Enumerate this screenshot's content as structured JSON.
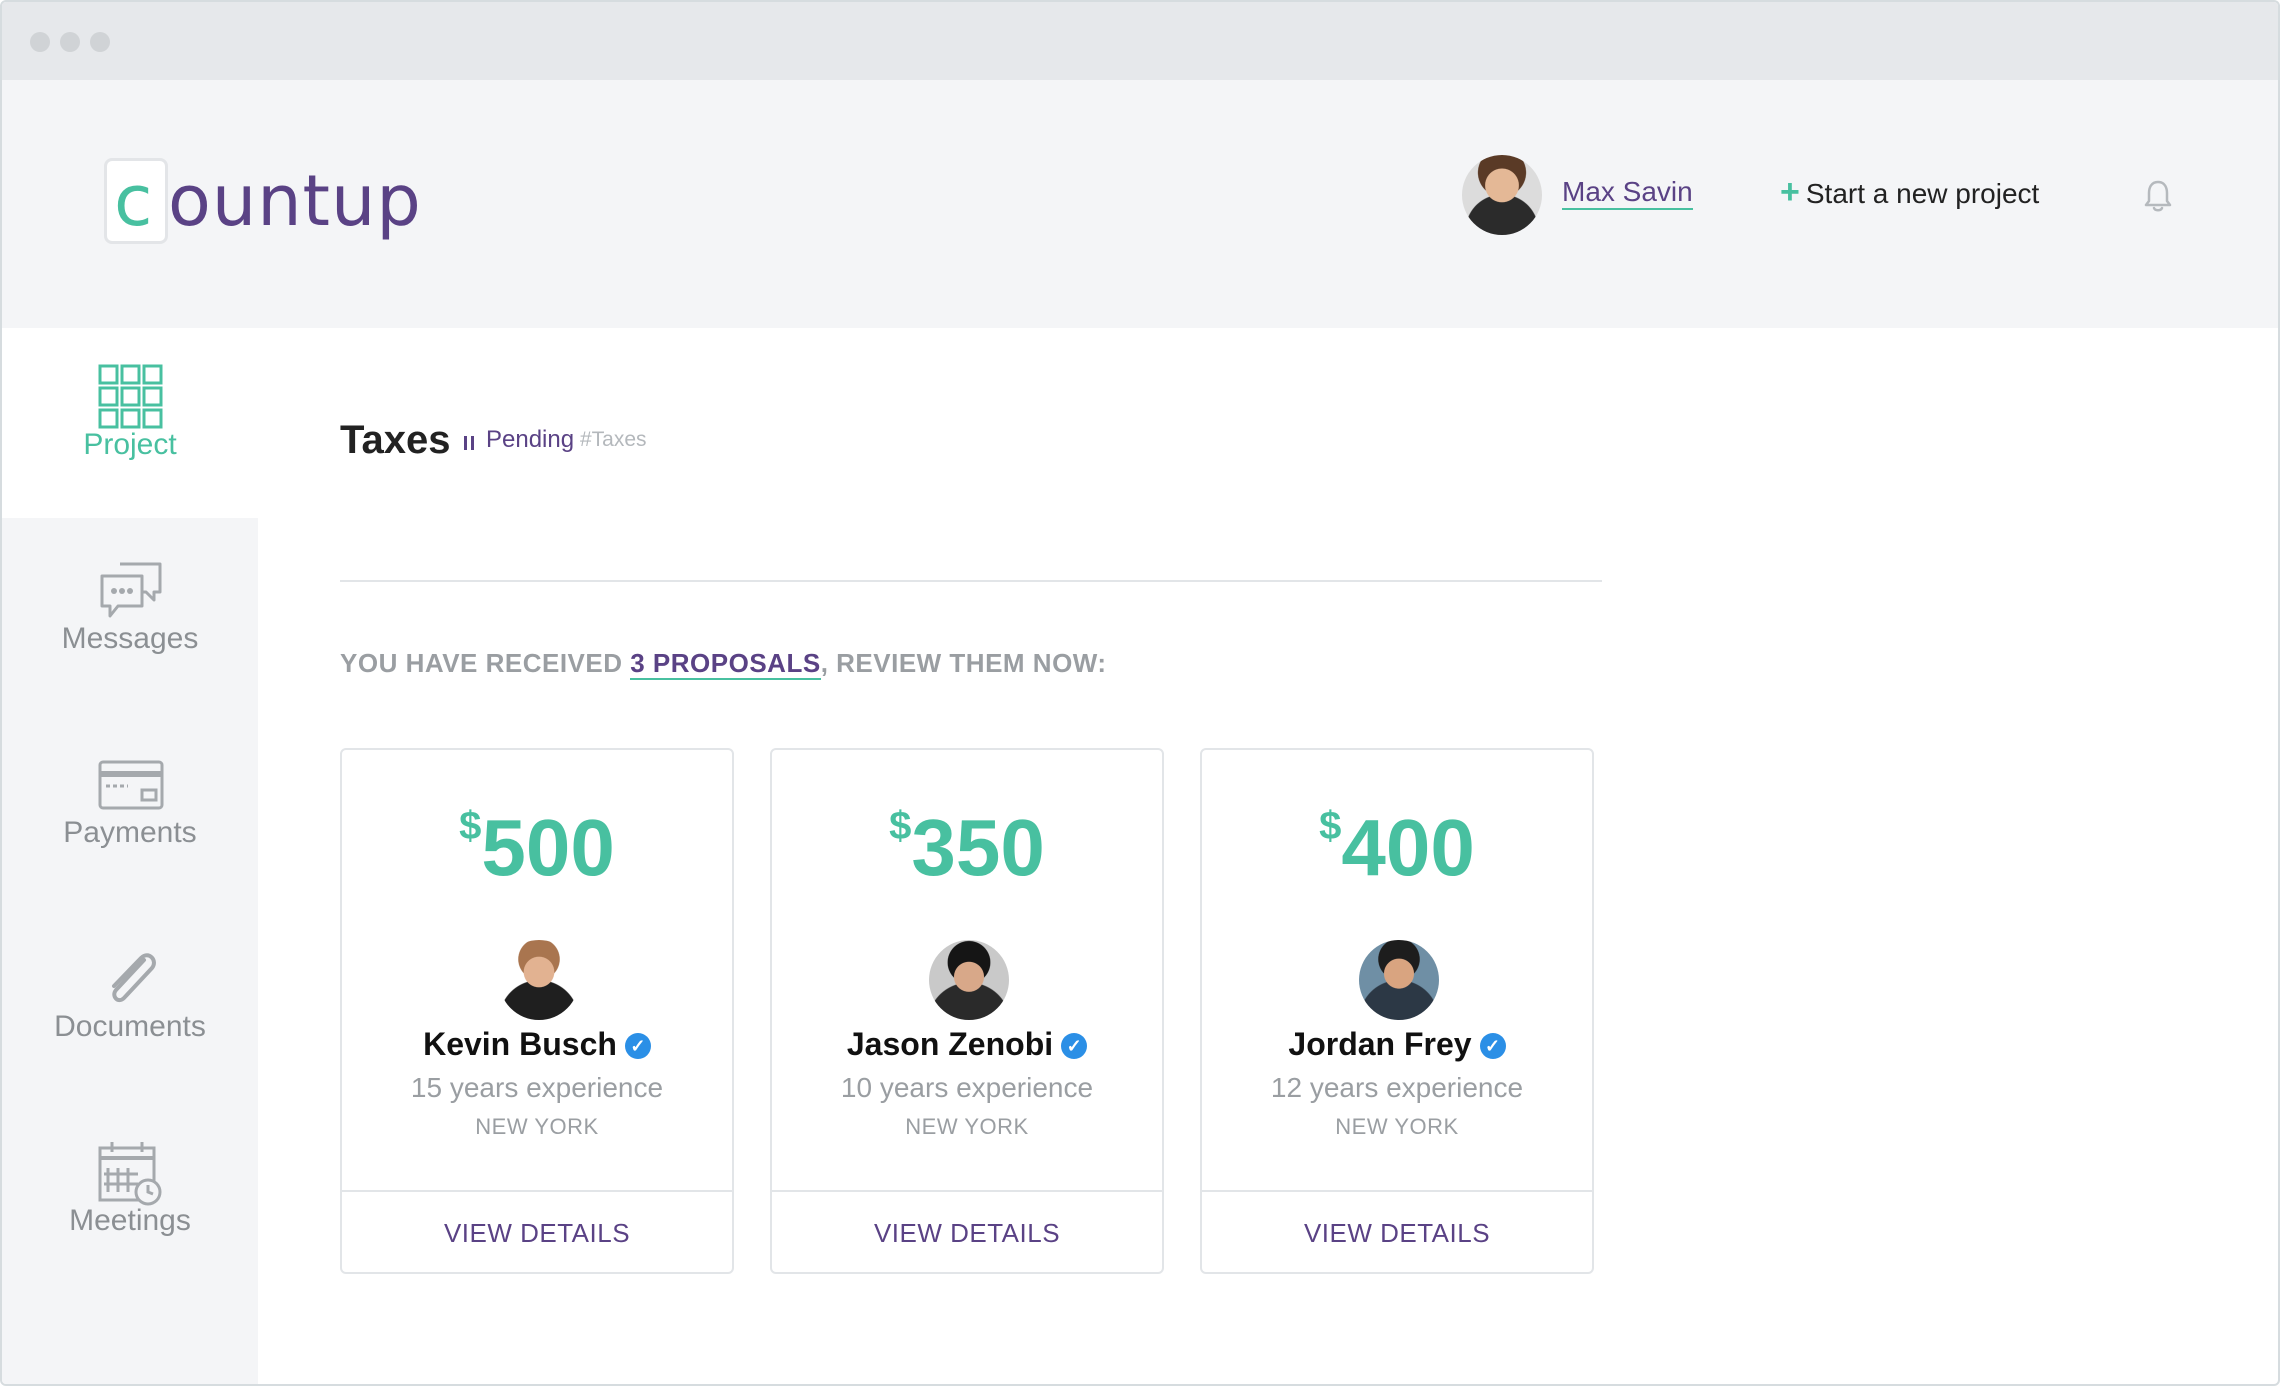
{
  "header": {
    "logo_c": "c",
    "logo_text": "ountup",
    "user_name": "Max Savin",
    "new_project_icon": "+",
    "new_project_label": "Start a new project"
  },
  "sidebar": {
    "items": [
      {
        "label": "Project",
        "icon": "grid-icon",
        "active": true
      },
      {
        "label": "Messages",
        "icon": "chat-icon",
        "active": false
      },
      {
        "label": "Payments",
        "icon": "credit-card-icon",
        "active": false
      },
      {
        "label": "Documents",
        "icon": "paperclip-icon",
        "active": false
      },
      {
        "label": "Meetings",
        "icon": "calendar-icon",
        "active": false
      }
    ]
  },
  "project": {
    "title": "Taxes",
    "status": "Pending",
    "tag": "#Taxes"
  },
  "proposals": {
    "prefix": "YOU HAVE RECEIVED ",
    "count_label": "3 PROPOSALS",
    "suffix": ", REVIEW THEM NOW:"
  },
  "cards": [
    {
      "currency": "$",
      "amount": "500",
      "name": "Kevin Busch",
      "experience": "15 years experience",
      "city": "NEW YORK",
      "button": "VIEW DETAILS"
    },
    {
      "currency": "$",
      "amount": "350",
      "name": "Jason Zenobi",
      "experience": "10 years experience",
      "city": "NEW YORK",
      "button": "VIEW DETAILS"
    },
    {
      "currency": "$",
      "amount": "400",
      "name": "Jordan Frey",
      "experience": "12 years experience",
      "city": "NEW YORK",
      "button": "VIEW DETAILS"
    }
  ],
  "colors": {
    "accent": "#48c0a0",
    "brand": "#5a4285",
    "verified": "#2b8fe6"
  }
}
